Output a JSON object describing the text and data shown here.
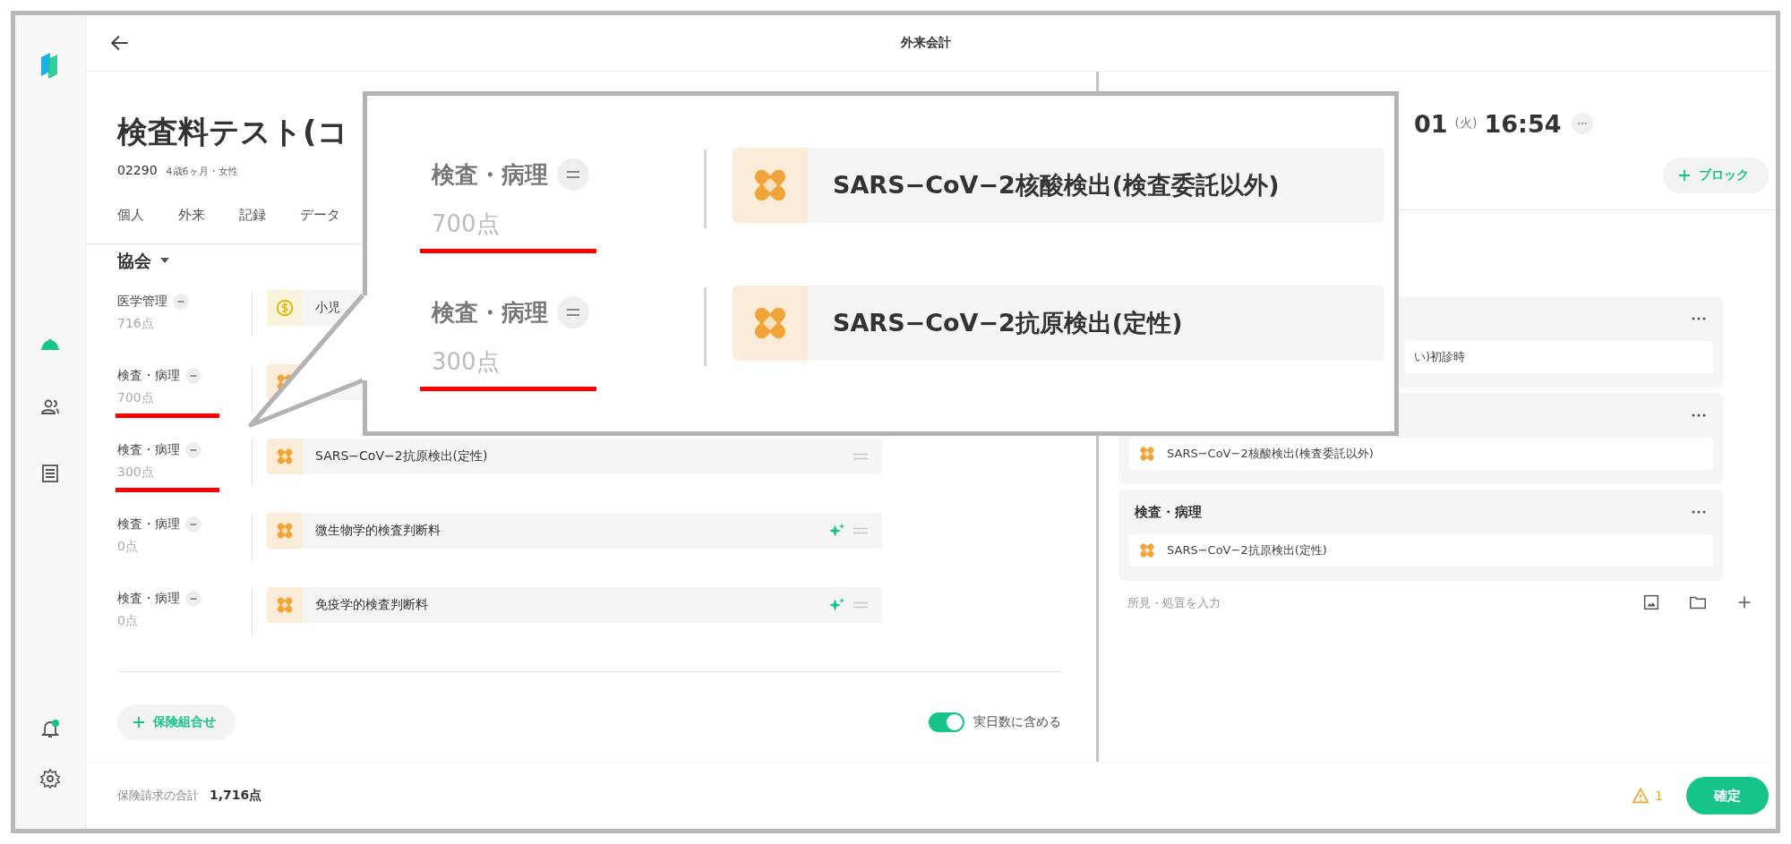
{
  "app": {
    "title": "外来会計"
  },
  "patient": {
    "name": "検査料テスト(コ",
    "id": "02290",
    "info": "4歳6ヶ月・女性"
  },
  "tabs": [
    {
      "label": "個人",
      "selected": false
    },
    {
      "label": "外来",
      "selected": false
    },
    {
      "label": "記録",
      "selected": false
    },
    {
      "label": "データ",
      "selected": false
    }
  ],
  "insurer": {
    "label": "協会"
  },
  "rows": [
    {
      "category": "医学管理",
      "points": "716点",
      "kind": "coin",
      "name": "小児",
      "suggested": false,
      "highlighted": false
    },
    {
      "category": "検査・病理",
      "points": "700点",
      "kind": "bandage",
      "suggested": false,
      "highlighted": true
    },
    {
      "category": "検査・病理",
      "points": "300点",
      "kind": "bandage",
      "name": "SARS−CoV−2抗原検出(定性)",
      "suggested": false,
      "handle": true,
      "highlighted": true
    },
    {
      "category": "検査・病理",
      "points": "0点",
      "kind": "bandage",
      "name": "微生物学的検査判断料",
      "suggested": true,
      "handle": true,
      "highlighted": false
    },
    {
      "category": "検査・病理",
      "points": "0点",
      "kind": "bandage",
      "name": "免疫学的検査判断料",
      "suggested": true,
      "handle": true,
      "highlighted": false
    }
  ],
  "add_insurance_button": "保険組合せ",
  "toggle": {
    "label": "実日数に含める",
    "on": true
  },
  "footer": {
    "total_label": "保険請求の合計",
    "total": "1,716点",
    "warning_count": "1",
    "confirm_button": "確定"
  },
  "record": {
    "date": "01",
    "weekday": "(火)",
    "time": "16:54",
    "add_block_button": "ブロック",
    "cards": [
      {
        "items": [
          {
            "kind": "text",
            "text": "い)初診時"
          }
        ]
      },
      {
        "items": [
          {
            "kind": "bandage",
            "text": "SARS−CoV−2核酸検出(検査委託以外)"
          }
        ]
      },
      {
        "title": "検査・病理",
        "items": [
          {
            "kind": "bandage",
            "text": "SARS−CoV−2抗原検出(定性)"
          }
        ]
      }
    ],
    "note_placeholder": "所見・処置を入力"
  },
  "callout": {
    "rows": [
      {
        "category": "検査・病理",
        "points": "700点",
        "name": "SARS−CoV−2核酸検出(検査委託以外)",
        "highlighted": true
      },
      {
        "category": "検査・病理",
        "points": "300点",
        "name": "SARS−CoV−2抗原検出(定性)",
        "highlighted": true
      }
    ]
  }
}
